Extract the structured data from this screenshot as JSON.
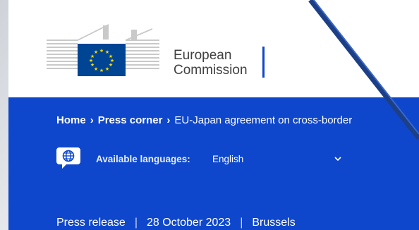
{
  "header": {
    "logo_line1": "European",
    "logo_line2": "Commission"
  },
  "breadcrumb": {
    "home": "Home",
    "press_corner": "Press corner",
    "current": "EU-Japan agreement on cross-border"
  },
  "languages": {
    "label": "Available languages:",
    "selected": "English",
    "icon": "globe-speech-icon"
  },
  "meta": {
    "type": "Press release",
    "date": "28 October 2023",
    "location": "Brussels"
  },
  "colors": {
    "brand_blue": "#0e47cb",
    "flag_blue": "#004494",
    "flag_yellow": "#ffdd00"
  }
}
